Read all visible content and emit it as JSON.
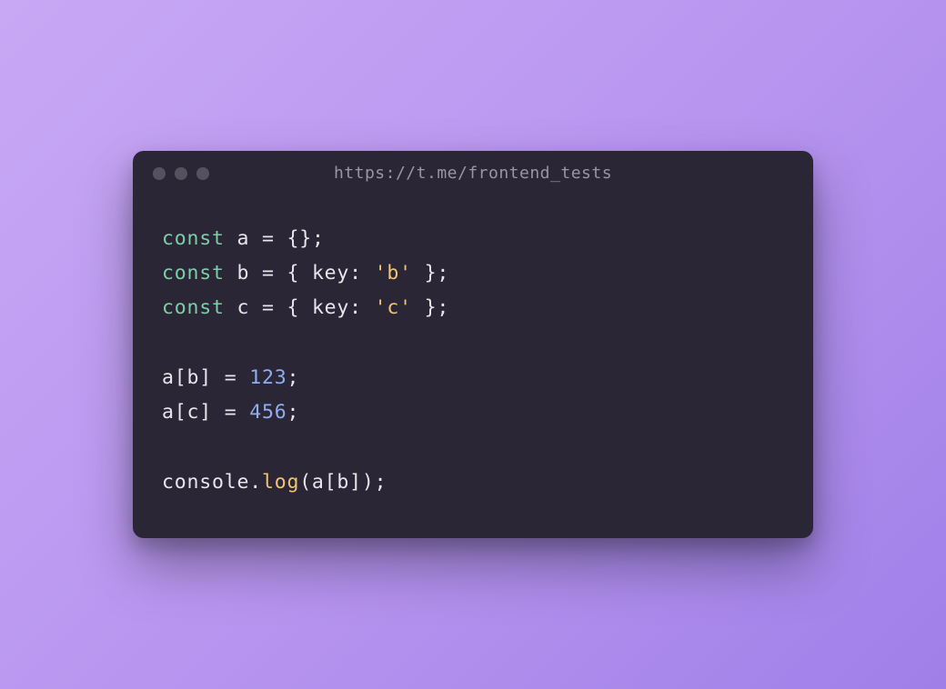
{
  "window": {
    "title": "https://t.me/frontend_tests"
  },
  "code": {
    "lines": [
      {
        "tokens": [
          {
            "type": "keyword",
            "text": "const"
          },
          {
            "type": "default",
            "text": " a = {};"
          }
        ]
      },
      {
        "tokens": [
          {
            "type": "keyword",
            "text": "const"
          },
          {
            "type": "default",
            "text": " b = { key: "
          },
          {
            "type": "string",
            "text": "'b'"
          },
          {
            "type": "default",
            "text": " };"
          }
        ]
      },
      {
        "tokens": [
          {
            "type": "keyword",
            "text": "const"
          },
          {
            "type": "default",
            "text": " c = { key: "
          },
          {
            "type": "string",
            "text": "'c'"
          },
          {
            "type": "default",
            "text": " };"
          }
        ]
      },
      {
        "blank": true
      },
      {
        "tokens": [
          {
            "type": "default",
            "text": "a[b] = "
          },
          {
            "type": "number",
            "text": "123"
          },
          {
            "type": "default",
            "text": ";"
          }
        ]
      },
      {
        "tokens": [
          {
            "type": "default",
            "text": "a[c] = "
          },
          {
            "type": "number",
            "text": "456"
          },
          {
            "type": "default",
            "text": ";"
          }
        ]
      },
      {
        "blank": true
      },
      {
        "tokens": [
          {
            "type": "default",
            "text": "console."
          },
          {
            "type": "method",
            "text": "log"
          },
          {
            "type": "default",
            "text": "(a[b]);"
          }
        ]
      }
    ]
  }
}
